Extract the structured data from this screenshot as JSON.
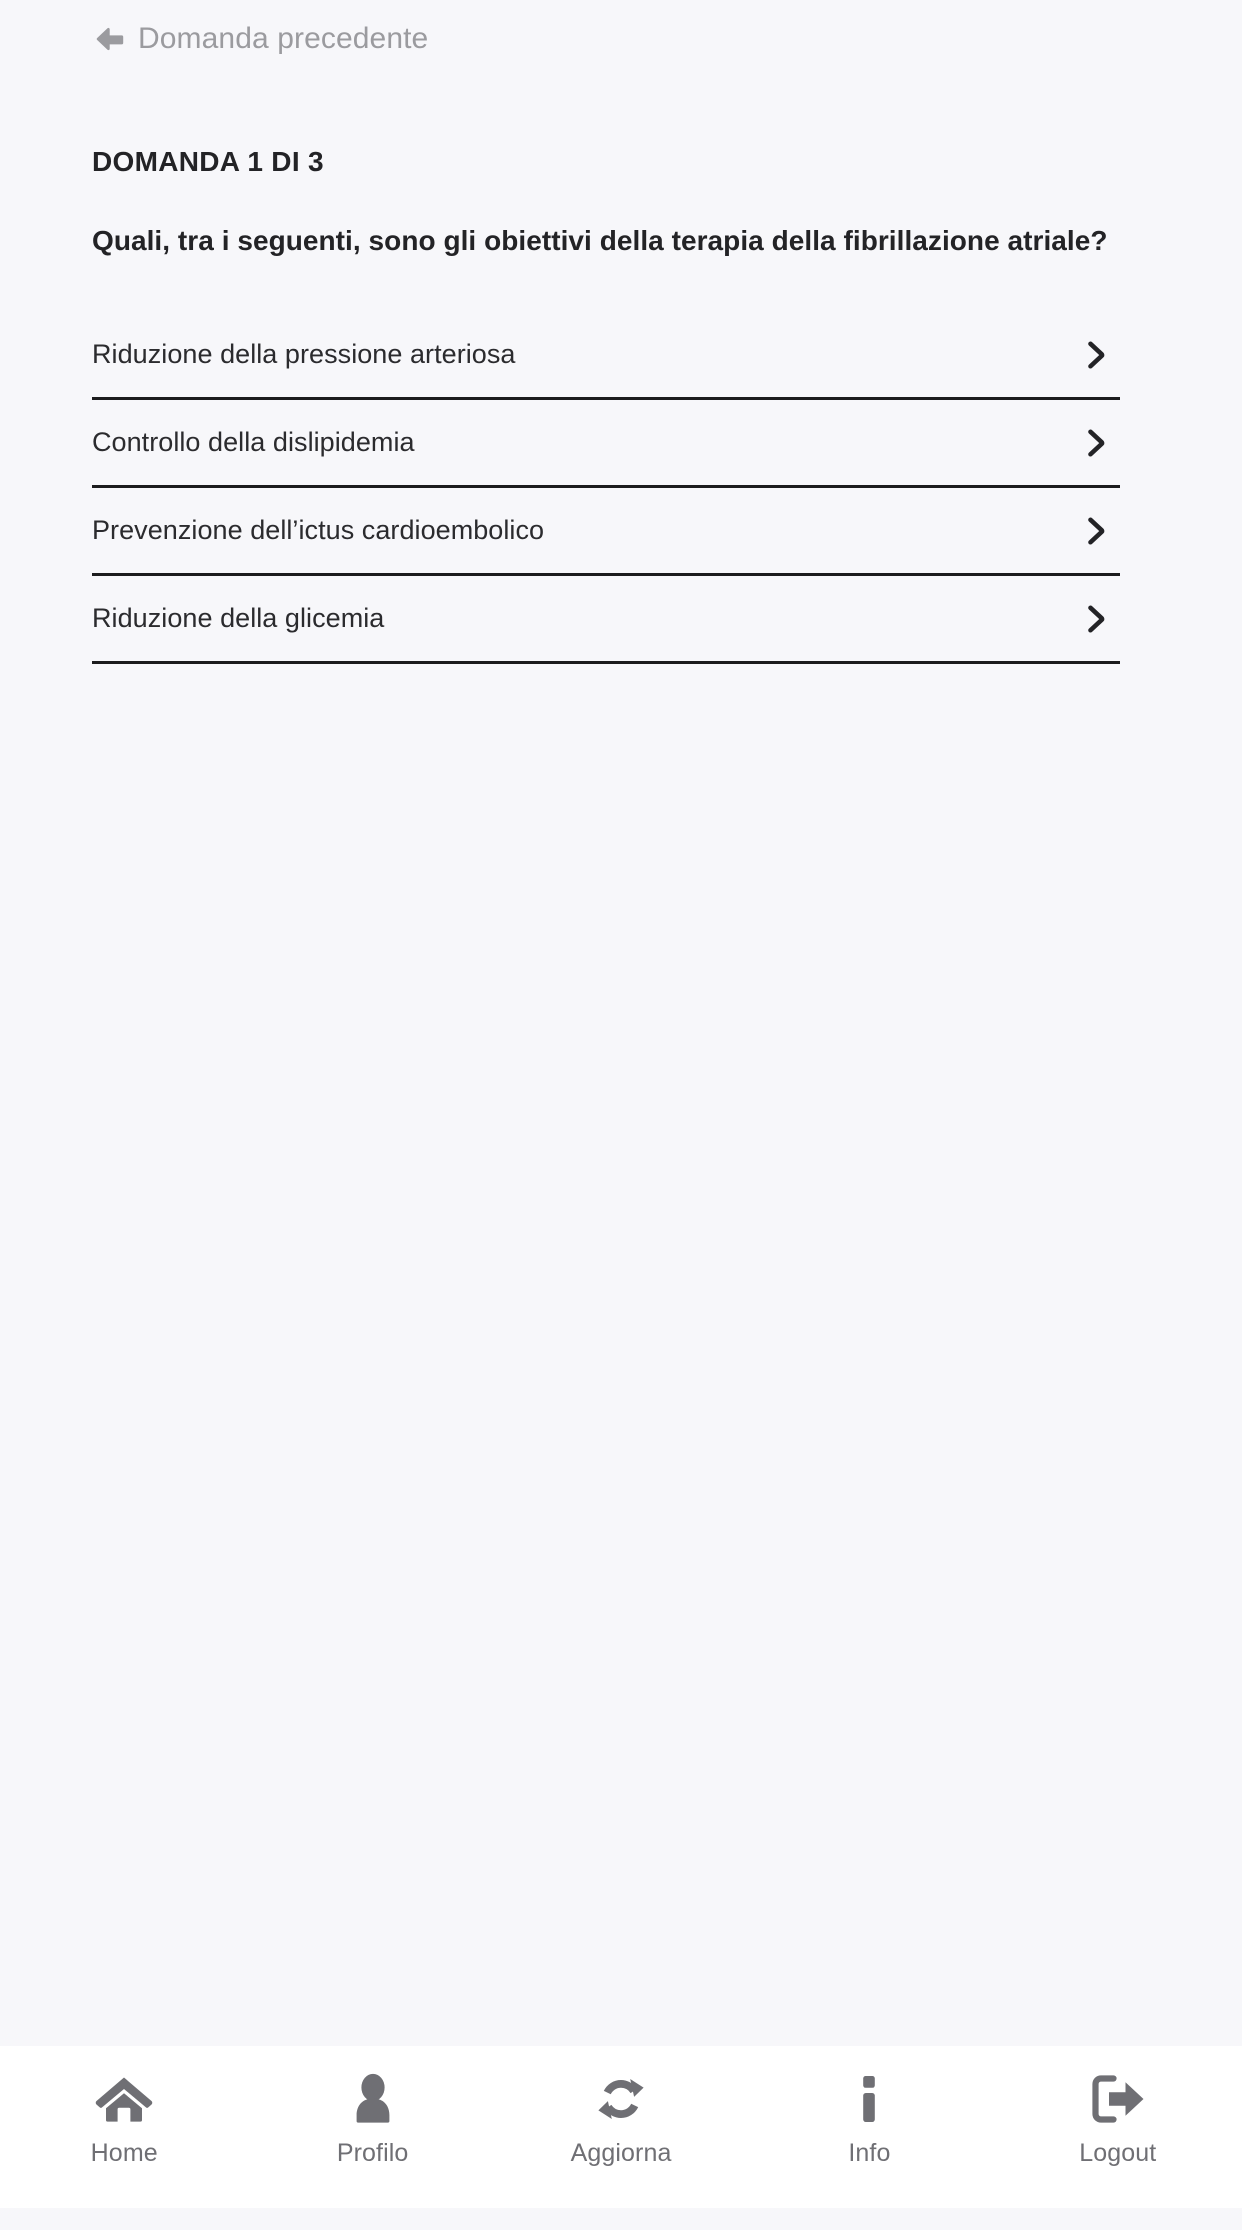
{
  "header": {
    "back_label": "Domanda precedente",
    "back_icon": "arrow-left-icon"
  },
  "quiz": {
    "counter": "DOMANDA 1 DI 3",
    "question": "Quali, tra i seguenti, sono gli obiettivi della terapia della fibrillazione atriale?",
    "options": [
      {
        "label": "Riduzione della pressione arteriosa",
        "chevron_icon": "chevron-right-icon"
      },
      {
        "label": "Controllo della dislipidemia",
        "chevron_icon": "chevron-right-icon"
      },
      {
        "label": "Prevenzione dell’ictus cardioembolico",
        "chevron_icon": "chevron-right-icon"
      },
      {
        "label": "Riduzione della glicemia",
        "chevron_icon": "chevron-right-icon"
      }
    ]
  },
  "tabbar": {
    "items": [
      {
        "label": "Home",
        "icon": "home-icon"
      },
      {
        "label": "Profilo",
        "icon": "user-icon"
      },
      {
        "label": "Aggiorna",
        "icon": "refresh-icon"
      },
      {
        "label": "Info",
        "icon": "info-icon"
      },
      {
        "label": "Logout",
        "icon": "logout-icon"
      }
    ]
  },
  "colors": {
    "page_background": "#f7f7fa",
    "tabbar_background": "#ffffff",
    "text_primary": "#232326",
    "text_muted": "#9b9b9f",
    "tab_icon": "#6f6f74",
    "separator": "#1c1c1e"
  }
}
